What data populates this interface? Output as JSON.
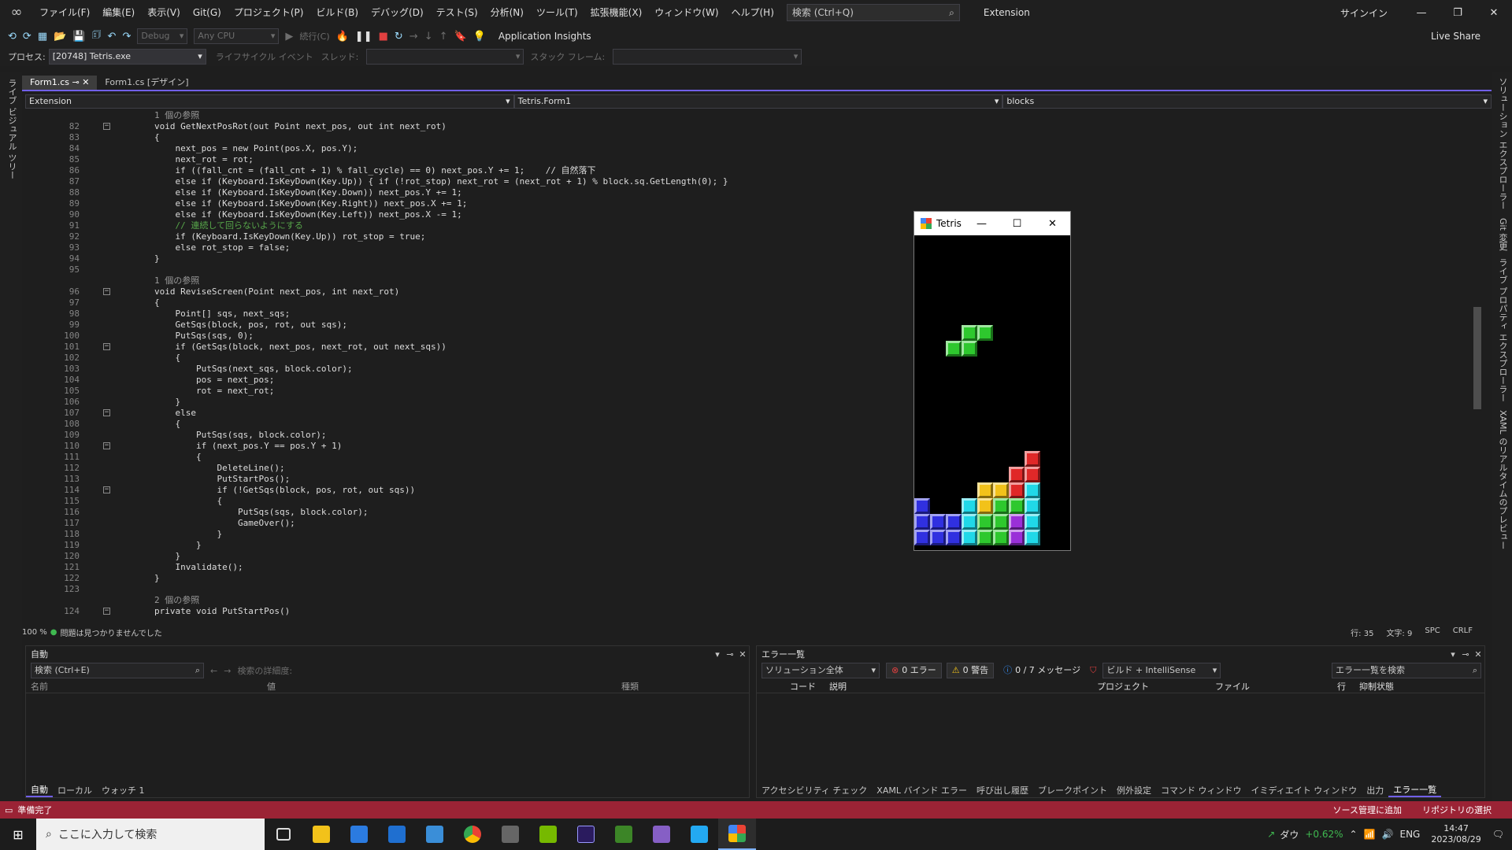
{
  "menubar": {
    "items": [
      "ファイル(F)",
      "編集(E)",
      "表示(V)",
      "Git(G)",
      "プロジェクト(P)",
      "ビルド(B)",
      "デバッグ(D)",
      "テスト(S)",
      "分析(N)",
      "ツール(T)",
      "拡張機能(X)",
      "ウィンドウ(W)",
      "ヘルプ(H)"
    ],
    "search_placeholder": "検索 (Ctrl+Q)",
    "solution_name": "Extension",
    "signin": "サインイン"
  },
  "toolbar": {
    "config": "Debug",
    "platform": "Any CPU",
    "continue_label": "続行(C)",
    "app_insights": "Application Insights",
    "live_share": "Live Share"
  },
  "procbar": {
    "process_label": "プロセス:",
    "process_value": "[20748] Tetris.exe",
    "lifecycle_label": "ライフサイクル イベント",
    "thread_label": "スレッド:",
    "stack_label": "スタック フレーム:"
  },
  "left_strip": {
    "label": "ライブ ビジュアル ツリー"
  },
  "right_strip": {
    "labels": [
      "ソリューション エクスプローラー",
      "Git 変更",
      "ライブ プロパティ エクスプローラー",
      "XAML のリアルタイムのプレビュー"
    ]
  },
  "tabs": [
    {
      "label": "Form1.cs"
    },
    {
      "label": "Form1.cs [デザイン]"
    }
  ],
  "navbar": {
    "project": "Extension",
    "class": "Tetris.Form1",
    "member": "blocks"
  },
  "editor": {
    "lines": [
      {
        "n": "",
        "t": "1 個の参照",
        "f": false
      },
      {
        "n": "82",
        "t": "void GetNextPosRot(out Point next_pos, out int next_rot)",
        "f": true
      },
      {
        "n": "83",
        "t": "{",
        "f": false
      },
      {
        "n": "84",
        "t": "    next_pos = new Point(pos.X, pos.Y);",
        "f": false
      },
      {
        "n": "85",
        "t": "    next_rot = rot;",
        "f": false
      },
      {
        "n": "86",
        "t": "    if ((fall_cnt = (fall_cnt + 1) % fall_cycle) == 0) next_pos.Y += 1;    // 自然落下",
        "f": false
      },
      {
        "n": "87",
        "t": "    else if (Keyboard.IsKeyDown(Key.Up)) { if (!rot_stop) next_rot = (next_rot + 1) % block.sq.GetLength(0); }",
        "f": false
      },
      {
        "n": "88",
        "t": "    else if (Keyboard.IsKeyDown(Key.Down)) next_pos.Y += 1;",
        "f": false
      },
      {
        "n": "89",
        "t": "    else if (Keyboard.IsKeyDown(Key.Right)) next_pos.X += 1;",
        "f": false
      },
      {
        "n": "90",
        "t": "    else if (Keyboard.IsKeyDown(Key.Left)) next_pos.X -= 1;",
        "f": false
      },
      {
        "n": "91",
        "t": "    // 連続して回らないようにする",
        "f": false
      },
      {
        "n": "92",
        "t": "    if (Keyboard.IsKeyDown(Key.Up)) rot_stop = true;",
        "f": false
      },
      {
        "n": "93",
        "t": "    else rot_stop = false;",
        "f": false
      },
      {
        "n": "94",
        "t": "}",
        "f": false
      },
      {
        "n": "95",
        "t": "",
        "f": false
      },
      {
        "n": "",
        "t": "1 個の参照",
        "f": false
      },
      {
        "n": "96",
        "t": "void ReviseScreen(Point next_pos, int next_rot)",
        "f": true
      },
      {
        "n": "97",
        "t": "{",
        "f": false
      },
      {
        "n": "98",
        "t": "    Point[] sqs, next_sqs;",
        "f": false
      },
      {
        "n": "99",
        "t": "    GetSqs(block, pos, rot, out sqs);",
        "f": false
      },
      {
        "n": "100",
        "t": "    PutSqs(sqs, 0);",
        "f": false
      },
      {
        "n": "101",
        "t": "    if (GetSqs(block, next_pos, next_rot, out next_sqs))",
        "f": true
      },
      {
        "n": "102",
        "t": "    {",
        "f": false
      },
      {
        "n": "103",
        "t": "        PutSqs(next_sqs, block.color);",
        "f": false
      },
      {
        "n": "104",
        "t": "        pos = next_pos;",
        "f": false
      },
      {
        "n": "105",
        "t": "        rot = next_rot;",
        "f": false
      },
      {
        "n": "106",
        "t": "    }",
        "f": false
      },
      {
        "n": "107",
        "t": "    else",
        "f": true
      },
      {
        "n": "108",
        "t": "    {",
        "f": false
      },
      {
        "n": "109",
        "t": "        PutSqs(sqs, block.color);",
        "f": false
      },
      {
        "n": "110",
        "t": "        if (next_pos.Y == pos.Y + 1)",
        "f": true
      },
      {
        "n": "111",
        "t": "        {",
        "f": false
      },
      {
        "n": "112",
        "t": "            DeleteLine();",
        "f": false
      },
      {
        "n": "113",
        "t": "            PutStartPos();",
        "f": false
      },
      {
        "n": "114",
        "t": "            if (!GetSqs(block, pos, rot, out sqs))",
        "f": true
      },
      {
        "n": "115",
        "t": "            {",
        "f": false
      },
      {
        "n": "116",
        "t": "                PutSqs(sqs, block.color);",
        "f": false
      },
      {
        "n": "117",
        "t": "                GameOver();",
        "f": false
      },
      {
        "n": "118",
        "t": "            }",
        "f": false
      },
      {
        "n": "119",
        "t": "        }",
        "f": false
      },
      {
        "n": "120",
        "t": "    }",
        "f": false
      },
      {
        "n": "121",
        "t": "    Invalidate();",
        "f": false
      },
      {
        "n": "122",
        "t": "}",
        "f": false
      },
      {
        "n": "123",
        "t": "",
        "f": false
      },
      {
        "n": "",
        "t": "2 個の参照",
        "f": false
      },
      {
        "n": "124",
        "t": "private void PutStartPos()",
        "f": true
      }
    ]
  },
  "editor_status": {
    "zoom": "100 %",
    "issues": "問題は見つかりませんでした",
    "line": "行: 35",
    "char": "文字: 9",
    "spc": "SPC",
    "crlf": "CRLF"
  },
  "tetris": {
    "title": "Tetris",
    "colors": {
      "green": "#2ec82e",
      "blue": "#3030e0",
      "cyan": "#20d8e8",
      "yellow": "#f2c21a",
      "red": "#e02828",
      "purple": "#9a30d8"
    }
  },
  "auto_panel": {
    "title": "自動",
    "search_placeholder": "検索 (Ctrl+E)",
    "depth_label": "検索の詳細度:",
    "columns": [
      "名前",
      "値",
      "種類"
    ],
    "tabs": [
      "自動",
      "ローカル",
      "ウォッチ 1"
    ]
  },
  "error_panel": {
    "title": "エラー一覧",
    "scope": "ソリューション全体",
    "errors": "0 エラー",
    "warnings": "0 警告",
    "messages": "0 / 7 メッセージ",
    "build_filter": "ビルド + IntelliSense",
    "search_placeholder": "エラー一覧を検索",
    "columns": [
      "コード",
      "説明",
      "プロジェクト",
      "ファイル",
      "行",
      "抑制状態"
    ],
    "tabs": [
      "アクセシビリティ チェック",
      "XAML バインド エラー",
      "呼び出し履歴",
      "ブレークポイント",
      "例外設定",
      "コマンド ウィンドウ",
      "イミディエイト ウィンドウ",
      "出力",
      "エラー一覧"
    ]
  },
  "statusbar": {
    "ready": "準備完了",
    "source_control": "ソース管理に追加",
    "repo": "リポジトリの選択"
  },
  "taskbar": {
    "search_placeholder": "ここに入力して検索",
    "stock_name": "ダウ",
    "stock_change": "+0.62%",
    "lang": "ENG",
    "time": "14:47",
    "date": "2023/08/29"
  }
}
